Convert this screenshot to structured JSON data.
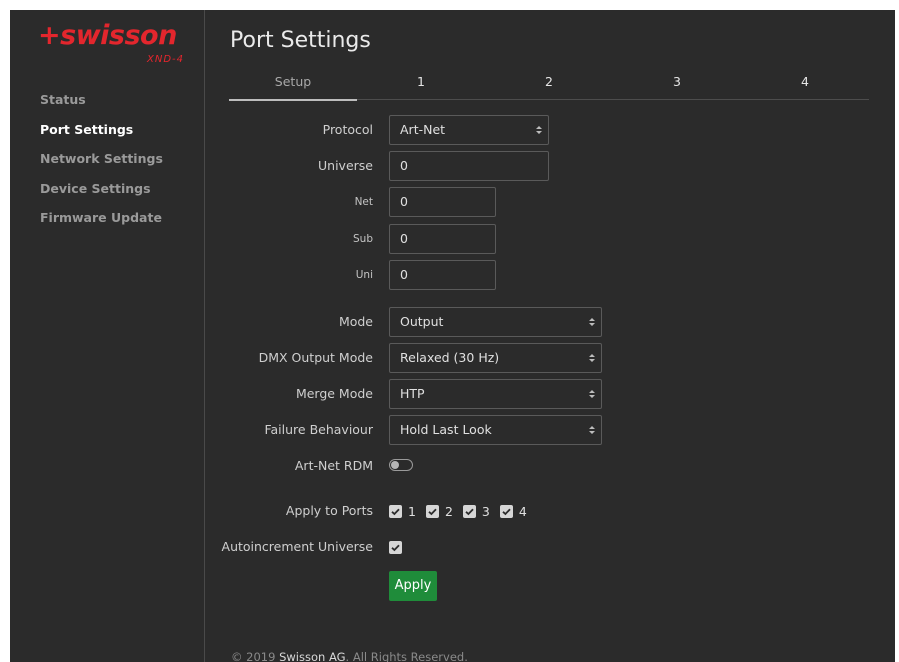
{
  "brand": {
    "logo_text": "+swisson",
    "model": "XND-4",
    "accent": "#e3262d"
  },
  "sidebar": {
    "items": [
      {
        "label": "Status",
        "active": false
      },
      {
        "label": "Port Settings",
        "active": true
      },
      {
        "label": "Network Settings",
        "active": false
      },
      {
        "label": "Device Settings",
        "active": false
      },
      {
        "label": "Firmware Update",
        "active": false
      }
    ]
  },
  "page": {
    "title": "Port Settings"
  },
  "tabs": [
    {
      "label": "Setup",
      "active": true
    },
    {
      "label": "1"
    },
    {
      "label": "2"
    },
    {
      "label": "3"
    },
    {
      "label": "4"
    }
  ],
  "form": {
    "protocol": {
      "label": "Protocol",
      "value": "Art-Net"
    },
    "universe": {
      "label": "Universe",
      "value": "0"
    },
    "net": {
      "label": "Net",
      "value": "0"
    },
    "sub": {
      "label": "Sub",
      "value": "0"
    },
    "uni": {
      "label": "Uni",
      "value": "0"
    },
    "mode": {
      "label": "Mode",
      "value": "Output"
    },
    "dmx_output_mode": {
      "label": "DMX Output Mode",
      "value": "Relaxed (30 Hz)"
    },
    "merge_mode": {
      "label": "Merge Mode",
      "value": "HTP"
    },
    "failure_behaviour": {
      "label": "Failure Behaviour",
      "value": "Hold Last Look"
    },
    "artnet_rdm": {
      "label": "Art-Net RDM",
      "enabled": false
    },
    "apply_to_ports": {
      "label": "Apply to Ports",
      "ports": [
        {
          "label": "1",
          "checked": true
        },
        {
          "label": "2",
          "checked": true
        },
        {
          "label": "3",
          "checked": true
        },
        {
          "label": "4",
          "checked": true
        }
      ]
    },
    "autoincrement": {
      "label": "Autoincrement Universe",
      "checked": true
    },
    "apply_label": "Apply",
    "apply_color": "#1f8c3a"
  },
  "footer": {
    "prefix": "© 2019 ",
    "company": "Swisson AG",
    "suffix": ". All Rights Reserved."
  }
}
